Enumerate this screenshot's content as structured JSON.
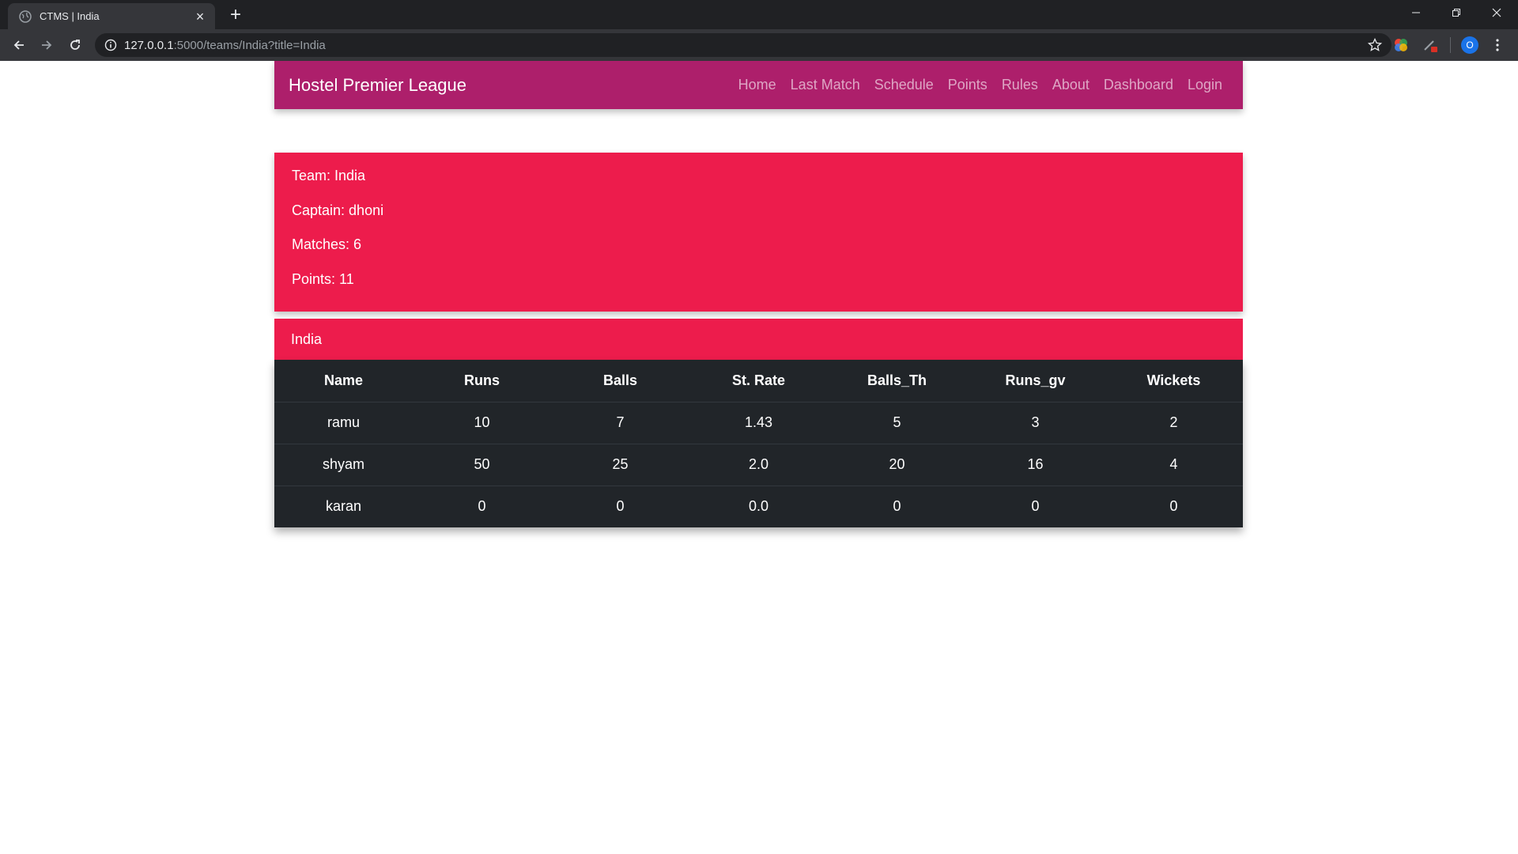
{
  "browser": {
    "tab_title": "CTMS | India",
    "url_host": "127.0.0.1",
    "url_rest": ":5000/teams/India?title=India",
    "profile_initial": "O"
  },
  "navbar": {
    "brand": "Hostel Premier League",
    "links": [
      "Home",
      "Last Match",
      "Schedule",
      "Points",
      "Rules",
      "About",
      "Dashboard",
      "Login"
    ]
  },
  "team": {
    "team_line": "Team: India",
    "captain_line": "Captain: dhoni",
    "matches_line": "Matches: 6",
    "points_line": "Points: 11"
  },
  "squad": {
    "title": "India",
    "columns": [
      "Name",
      "Runs",
      "Balls",
      "St. Rate",
      "Balls_Th",
      "Runs_gv",
      "Wickets"
    ],
    "rows": [
      [
        "ramu",
        "10",
        "7",
        "1.43",
        "5",
        "3",
        "2"
      ],
      [
        "shyam",
        "50",
        "25",
        "2.0",
        "20",
        "16",
        "4"
      ],
      [
        "karan",
        "0",
        "0",
        "0.0",
        "0",
        "0",
        "0"
      ]
    ]
  },
  "colors": {
    "navbar_bg": "#ad1f6b",
    "card_bg": "#ed1c4c",
    "table_bg": "#212529"
  }
}
